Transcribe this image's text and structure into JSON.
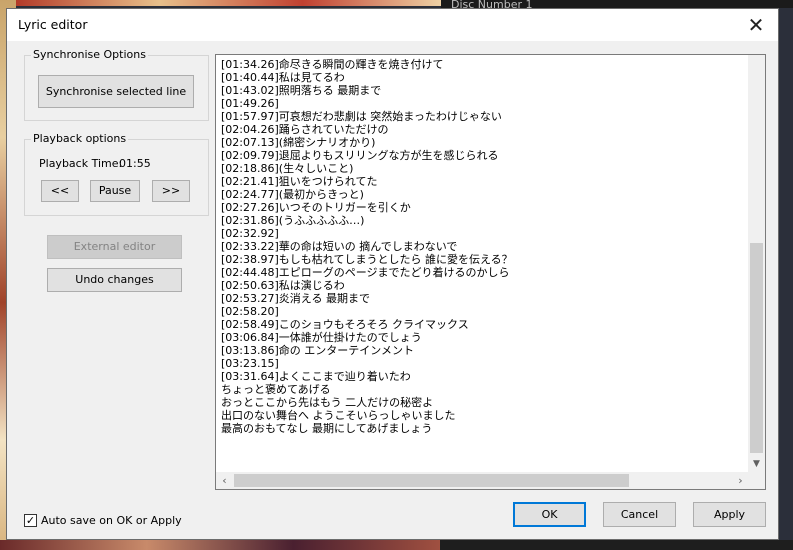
{
  "background": {
    "disc_number_label": "Disc Number    1"
  },
  "dialog": {
    "title": "Lyric editor",
    "sync_group": {
      "label": "Synchronise Options",
      "sync_button": "Synchronise selected line"
    },
    "playback_group": {
      "label": "Playback options",
      "time_label": "Playback Time:",
      "time_value": "01:55",
      "rewind_button": "<<",
      "pause_button": "Pause",
      "forward_button": ">>"
    },
    "external_editor_button": "External editor",
    "undo_button": "Undo changes",
    "lyrics": [
      "[01:34.26]命尽きる瞬間の輝きを焼き付けて",
      "[01:40.44]私は見てるわ",
      "[01:43.02]照明落ちる 最期まで",
      "[01:49.26]",
      "[01:57.97]可哀想だわ悲劇は 突然始まったわけじゃない",
      "[02:04.26]踊らされていただけの",
      "[02:07.13](綿密シナリオかり)",
      "[02:09.79]退屈よりもスリリングな方が生を感じられる",
      "[02:18.86](生々しいこと)",
      "[02:21.41]狙いをつけられてた",
      "[02:24.77](最初からきっと)",
      "[02:27.26]いつそのトリガーを引くか",
      "[02:31.86](うふふふふふ…)",
      "[02:32.92]",
      "[02:33.22]華の命は短いの 摘んでしまわないで",
      "[02:38.97]もしも枯れてしまうとしたら 誰に愛を伝える？",
      "[02:44.48]エピローグのページまでたどり着けるのかしら",
      "[02:50.63]私は演じるわ",
      "[02:53.27]炎消える 最期まで",
      "[02:58.20]",
      "[02:58.49]このショウもそろそろ クライマックス",
      "[03:06.84]一体誰が仕掛けたのでしょう",
      "[03:13.86]命の エンターテインメント",
      "[03:23.15]",
      "[03:31.64]よくここまで辿り着いたわ",
      "ちょっと褒めてあげる",
      "おっとここから先はもう 二人だけの秘密よ",
      "出口のない舞台へ ようこそいらっしゃいました",
      "最高のおもてなし 最期にしてあげましょう"
    ],
    "auto_save_label": "Auto save on OK or Apply",
    "auto_save_checked": true,
    "ok_button": "OK",
    "cancel_button": "Cancel",
    "apply_button": "Apply"
  }
}
